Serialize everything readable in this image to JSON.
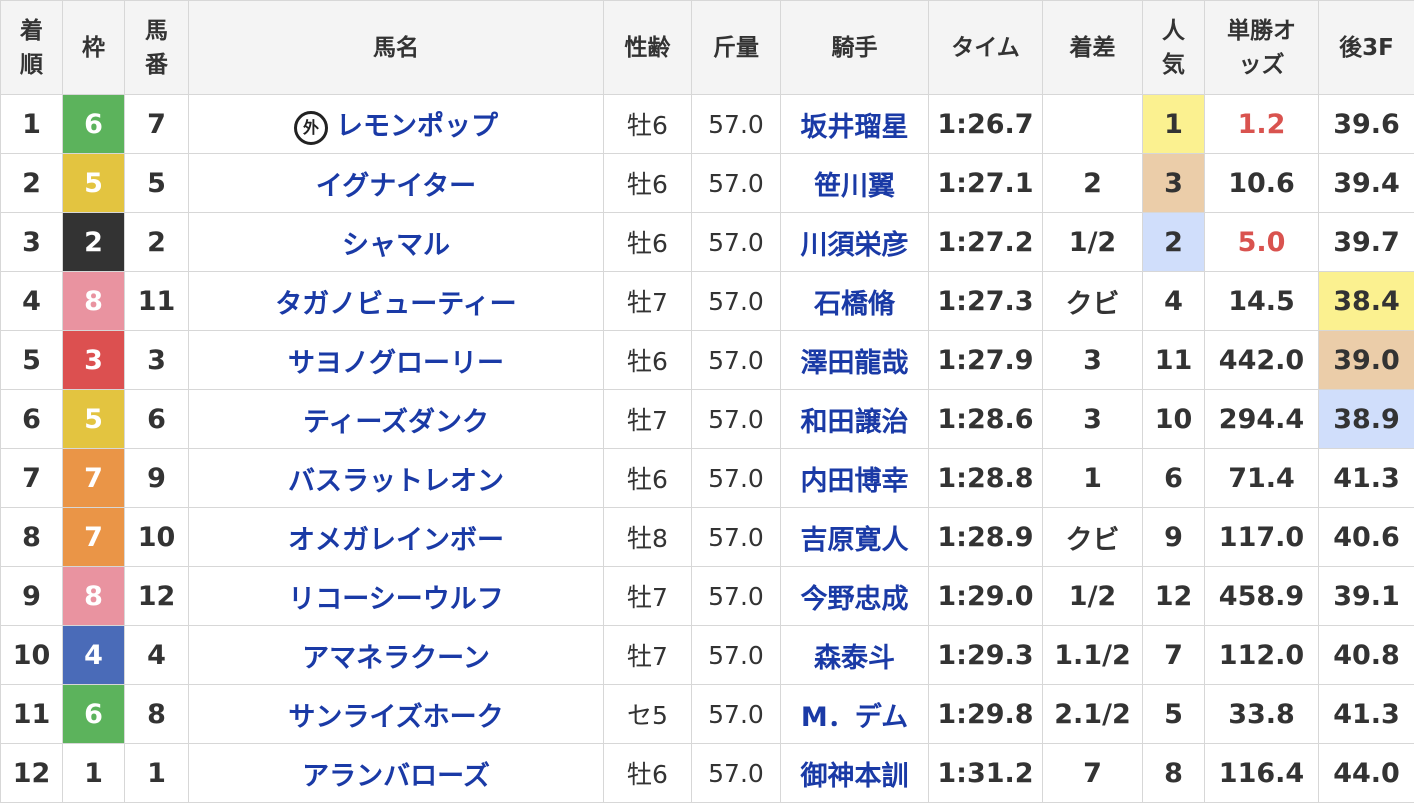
{
  "colors": {
    "frames": {
      "1": {
        "bg": "#ffffff",
        "fg": "#333333"
      },
      "2": {
        "bg": "#333333",
        "fg": "#ffffff"
      },
      "3": {
        "bg": "#dc5050",
        "fg": "#ffffff"
      },
      "4": {
        "bg": "#4a6bb8",
        "fg": "#ffffff"
      },
      "5": {
        "bg": "#e3c440",
        "fg": "#ffffff"
      },
      "6": {
        "bg": "#5cb35c",
        "fg": "#ffffff"
      },
      "7": {
        "bg": "#ea9547",
        "fg": "#ffffff"
      },
      "8": {
        "bg": "#e993a0",
        "fg": "#ffffff"
      }
    },
    "rank1": "#fbf190",
    "rank2": "#d0defb",
    "rank3": "#ebcda9",
    "odds_fav": "#d9534f"
  },
  "headers": {
    "order": "着順",
    "frame": "枠",
    "horse_no": "馬番",
    "name": "馬名",
    "sexage": "性齢",
    "weight": "斤量",
    "jockey": "騎手",
    "time": "タイム",
    "margin": "着差",
    "pop": "人気",
    "odds": "単勝オッズ",
    "l3f": "後3F"
  },
  "rows": [
    {
      "order": "1",
      "frame": "6",
      "horse_no": "7",
      "mark": "外",
      "name": "レモンポップ",
      "sexage": "牡6",
      "weight": "57.0",
      "jockey": "坂井瑠星",
      "time": "1:26.7",
      "margin": "",
      "pop": "1",
      "odds": "1.2",
      "l3f": "39.6"
    },
    {
      "order": "2",
      "frame": "5",
      "horse_no": "5",
      "name": "イグナイター",
      "sexage": "牡6",
      "weight": "57.0",
      "jockey": "笹川翼",
      "time": "1:27.1",
      "margin": "2",
      "pop": "3",
      "odds": "10.6",
      "l3f": "39.4"
    },
    {
      "order": "3",
      "frame": "2",
      "horse_no": "2",
      "name": "シャマル",
      "sexage": "牡6",
      "weight": "57.0",
      "jockey": "川須栄彦",
      "time": "1:27.2",
      "margin": "1/2",
      "pop": "2",
      "odds": "5.0",
      "l3f": "39.7"
    },
    {
      "order": "4",
      "frame": "8",
      "horse_no": "11",
      "name": "タガノビューティー",
      "sexage": "牡7",
      "weight": "57.0",
      "jockey": "石橋脩",
      "time": "1:27.3",
      "margin": "クビ",
      "pop": "4",
      "odds": "14.5",
      "l3f": "38.4"
    },
    {
      "order": "5",
      "frame": "3",
      "horse_no": "3",
      "name": "サヨノグローリー",
      "sexage": "牡6",
      "weight": "57.0",
      "jockey": "澤田龍哉",
      "time": "1:27.9",
      "margin": "3",
      "pop": "11",
      "odds": "442.0",
      "l3f": "39.0"
    },
    {
      "order": "6",
      "frame": "5",
      "horse_no": "6",
      "name": "ティーズダンク",
      "sexage": "牡7",
      "weight": "57.0",
      "jockey": "和田譲治",
      "time": "1:28.6",
      "margin": "3",
      "pop": "10",
      "odds": "294.4",
      "l3f": "38.9"
    },
    {
      "order": "7",
      "frame": "7",
      "horse_no": "9",
      "name": "バスラットレオン",
      "sexage": "牡6",
      "weight": "57.0",
      "jockey": "内田博幸",
      "time": "1:28.8",
      "margin": "1",
      "pop": "6",
      "odds": "71.4",
      "l3f": "41.3"
    },
    {
      "order": "8",
      "frame": "7",
      "horse_no": "10",
      "name": "オメガレインボー",
      "sexage": "牡8",
      "weight": "57.0",
      "jockey": "吉原寛人",
      "time": "1:28.9",
      "margin": "クビ",
      "pop": "9",
      "odds": "117.0",
      "l3f": "40.6"
    },
    {
      "order": "9",
      "frame": "8",
      "horse_no": "12",
      "name": "リコーシーウルフ",
      "sexage": "牡7",
      "weight": "57.0",
      "jockey": "今野忠成",
      "time": "1:29.0",
      "margin": "1/2",
      "pop": "12",
      "odds": "458.9",
      "l3f": "39.1"
    },
    {
      "order": "10",
      "frame": "4",
      "horse_no": "4",
      "name": "アマネラクーン",
      "sexage": "牡7",
      "weight": "57.0",
      "jockey": "森泰斗",
      "time": "1:29.3",
      "margin": "1.1/2",
      "pop": "7",
      "odds": "112.0",
      "l3f": "40.8"
    },
    {
      "order": "11",
      "frame": "6",
      "horse_no": "8",
      "name": "サンライズホーク",
      "sexage": "セ5",
      "weight": "57.0",
      "jockey": "M．デム",
      "time": "1:29.8",
      "margin": "2.1/2",
      "pop": "5",
      "odds": "33.8",
      "l3f": "41.3"
    },
    {
      "order": "12",
      "frame": "1",
      "horse_no": "1",
      "name": "アランバローズ",
      "sexage": "牡6",
      "weight": "57.0",
      "jockey": "御神本訓",
      "time": "1:31.2",
      "margin": "7",
      "pop": "8",
      "odds": "116.4",
      "l3f": "44.0"
    }
  ]
}
